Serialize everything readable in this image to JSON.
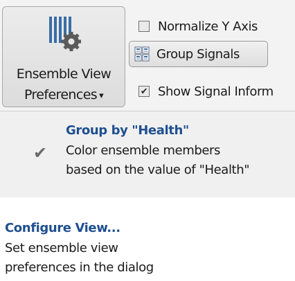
{
  "toolstrip": {
    "ensemble_button": {
      "label_line1": "Ensemble View",
      "label_line2": "Preferences",
      "caret": "▾",
      "icon": "ensemble-gear-icon"
    },
    "normalize_y": {
      "label": "Normalize Y Axis",
      "checked": false
    },
    "group_signals": {
      "label": "Group Signals",
      "icon": "grid-icon"
    },
    "show_signal_info": {
      "label": "Show Signal Inform",
      "checked": true,
      "check_glyph": "✔"
    }
  },
  "menu": {
    "group_by": {
      "check_glyph": "✔",
      "title": "Group by \"Health\"",
      "desc_line1": "Color ensemble members",
      "desc_line2": "based on the value of \"Health\""
    },
    "configure": {
      "title": "Configure View...",
      "desc_line1": "Set ensemble view",
      "desc_line2": "preferences in the dialog"
    }
  }
}
